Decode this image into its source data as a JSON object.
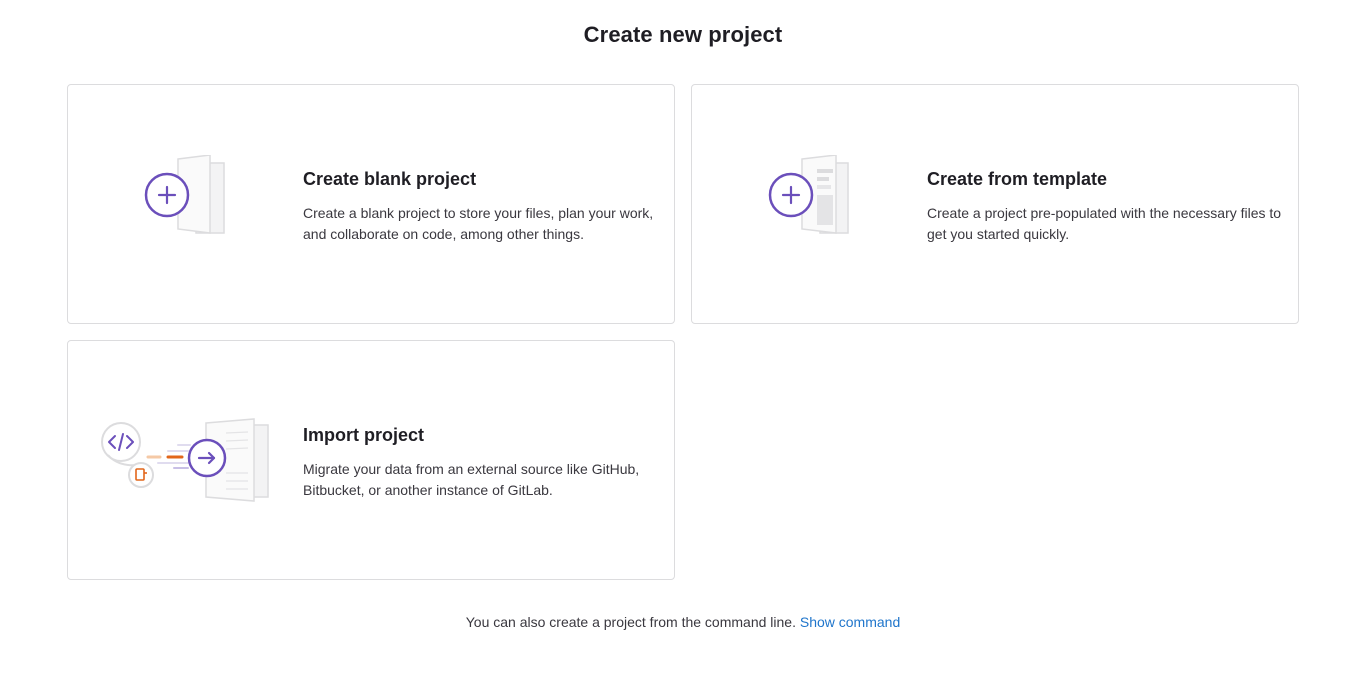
{
  "page": {
    "title": "Create new project"
  },
  "cards": [
    {
      "id": "blank",
      "title": "Create blank project",
      "description": "Create a blank project to store your files, plan your work, and collaborate on code, among other things.",
      "icon": "plus-circle-icon"
    },
    {
      "id": "template",
      "title": "Create from template",
      "description": "Create a project pre-populated with the necessary files to get you started quickly.",
      "icon": "plus-circle-icon"
    },
    {
      "id": "import",
      "title": "Import project",
      "description": "Migrate your data from an external source like GitHub, Bitbucket, or another instance of GitLab.",
      "icon": "arrow-right-circle-icon"
    }
  ],
  "footer": {
    "text": "You can also create a project from the command line.",
    "link_label": "Show command"
  },
  "colors": {
    "accent_purple": "#6b4fbb",
    "link_blue": "#1f75cb",
    "border_gray": "#dcdcde",
    "orange": "#e2661a"
  }
}
